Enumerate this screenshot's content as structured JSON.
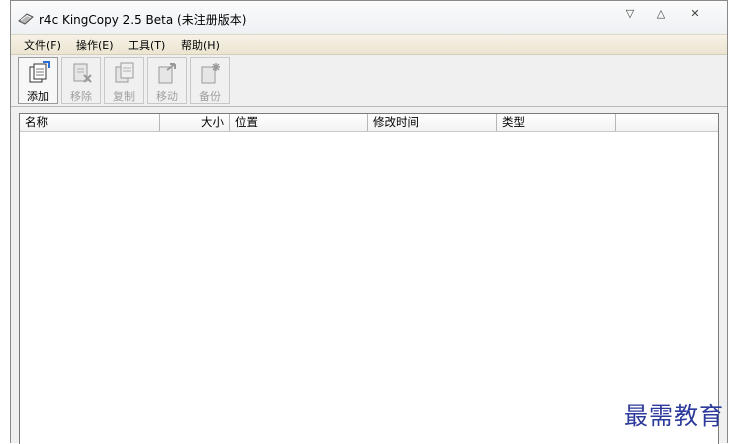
{
  "window": {
    "title": "r4c KingCopy 2.5 Beta (未注册版本)"
  },
  "window_controls": {
    "minimize": "▽",
    "maximize": "△",
    "close": "✕"
  },
  "menu": [
    "文件(F)",
    "操作(E)",
    "工具(T)",
    "帮助(H)"
  ],
  "toolbar": [
    {
      "label": "添加",
      "icon": "add-file-icon",
      "enabled": true
    },
    {
      "label": "移除",
      "icon": "remove-file-icon",
      "enabled": false
    },
    {
      "label": "复制",
      "icon": "copy-file-icon",
      "enabled": false
    },
    {
      "label": "移动",
      "icon": "move-file-icon",
      "enabled": false
    },
    {
      "label": "备份",
      "icon": "backup-file-icon",
      "enabled": false
    }
  ],
  "list": {
    "columns": [
      "名称",
      "大小",
      "位置",
      "修改时间",
      "类型"
    ],
    "rows": []
  },
  "watermark": "最需教育"
}
